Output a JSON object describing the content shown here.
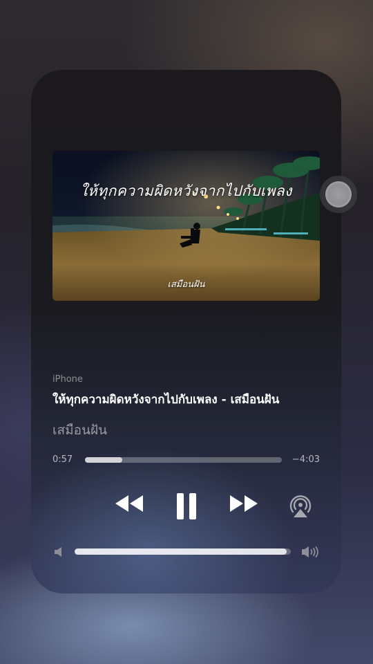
{
  "now_playing": {
    "device": "iPhone",
    "title": "ให้ทุกความผิดหวังจากไปกับเพลง - เสมือนฝัน",
    "artist": "เสมือนฝัน",
    "artwork": {
      "title_text": "ให้ทุกความผิดหวังจากไปกับเพลง",
      "artist_text": "เสมือนฝัน"
    }
  },
  "playback": {
    "elapsed": "0:57",
    "remaining": "−4:03",
    "progress": 0.19,
    "state": "playing"
  },
  "volume": {
    "level": 0.98
  },
  "icons": {
    "rewind": "rewind-icon",
    "pause": "pause-icon",
    "forward": "fast-forward-icon",
    "airplay": "airplay-audio-icon",
    "volume_low": "speaker-low-icon",
    "volume_high": "speaker-high-icon",
    "assistive_touch": "assistive-touch-button"
  },
  "colors": {
    "text_primary": "#ffffff",
    "text_secondary": "#8e8e93",
    "track": "#5a5a66"
  }
}
